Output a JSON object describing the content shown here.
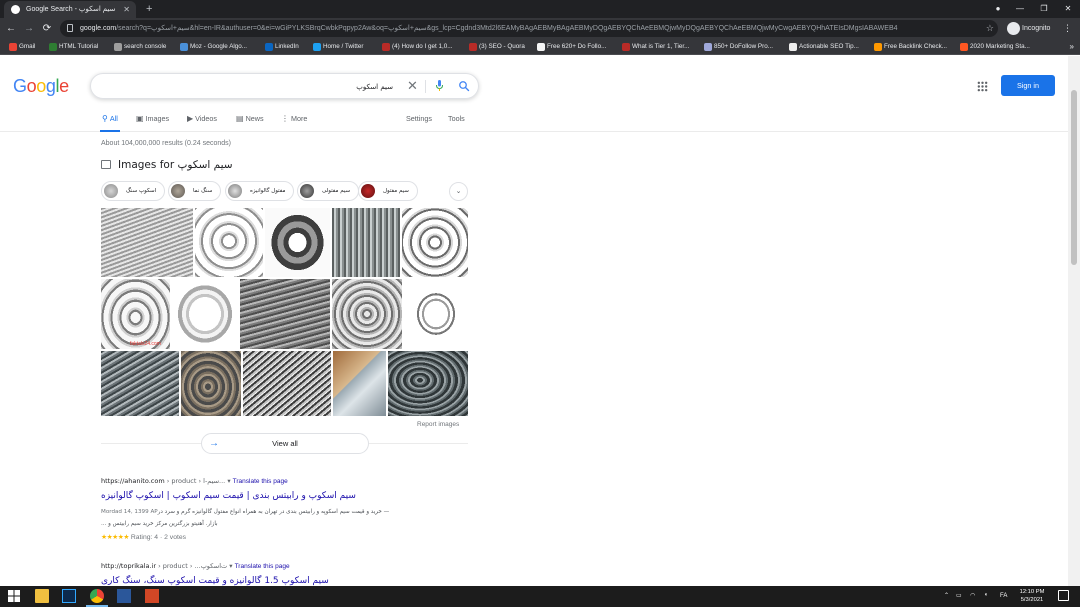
{
  "browser": {
    "tab_title": "Google Search - سیم اسکوپ",
    "new_tab": "+",
    "url_domain": "google.com",
    "url_rest": "/search?q=سیم+اسکوپ&hl=en-IR&authuser=0&ei=wGiPYLKSBrqCwbkPqpyp2Aw&oq=سیم+اسکوپ&gs_lcp=Cgdnd3Mtd2l6EAMyBAgAEBMyBAgAEBMyDQgAEBYQChAeEBMQjwMyDQgAEBYQChAeEBMQjwMyCwgAEBYQHhATEIsDMgsIABAWEB4",
    "incognito_label": "Incognito",
    "bookmarks": [
      "Gmail",
      "HTML Tutorial",
      "search console",
      "Moz - Google Algo...",
      "LinkedIn",
      "Home / Twitter",
      "(4) How do I get 1,0...",
      "(3) SEO - Quora",
      "Free 620+ Do Follo...",
      "What is Tier 1, Tier...",
      "850+ DoFollow Pro...",
      "Actionable SEO Tip...",
      "Free Backlink Check...",
      "2020 Marketing Sta..."
    ],
    "bookmark_more": "»"
  },
  "google": {
    "logo": [
      "G",
      "o",
      "o",
      "g",
      "l",
      "e"
    ],
    "query": "سیم اسکوپ",
    "signin": "Sign in",
    "tabs": [
      "All",
      "Images",
      "Videos",
      "News",
      "More"
    ],
    "settings": "Settings",
    "tools": "Tools",
    "stats": "About 104,000,000 results (0.24 seconds)",
    "images_for_prefix": "Images for",
    "images_for_query": "سیم اسکوپ",
    "chips": [
      "اسکوپ سنگ",
      "سنگ نما",
      "مفتول گالوانیزه",
      "سیم مفتولی",
      "سیم مفتول"
    ],
    "image_watermark": "faktals24.com",
    "report_images": "Report images",
    "view_all": "View all"
  },
  "results": [
    {
      "cite_domain": "https://ahanito.com",
      "cite_path": " › product › سیم-ا...",
      "translate": "Translate this page",
      "title": "سیم اسکوپ و رابیتس بندی | قیمت سیم اسکوپ | اسکوپ گالوانیزه",
      "date": "Mordad 14, 1399 AP",
      "snippet_1": " — خرید و قیمت سیم اسکوپه و رابیتس بندی در تهران به همراه انواع مفتول گالوانیزه گرم و سرد در",
      "snippet_2": "بازار. آهنیتو بزرگترین مرکز خرید سیم رابیتس و ...",
      "stars": "★★★★★",
      "rating": "Rating: 4",
      "votes": "2 votes"
    },
    {
      "cite_domain": "http://toprikala.ir",
      "cite_path": " › product › ...ت‌اسکوپ",
      "translate": "Translate this page",
      "title": "سیم اسکوپ 1.5 گالوانیزه و قیمت اسکوپ سنگ، سنگ کاری"
    }
  ],
  "taskbar": {
    "time": "12:10 PM",
    "date": "5/3/2021",
    "lang": "FA"
  },
  "colors": {
    "link": "#1a0dab",
    "accent": "#1a73e8",
    "chrome_dark": "#202124",
    "chrome_toolbar": "#35363a"
  }
}
